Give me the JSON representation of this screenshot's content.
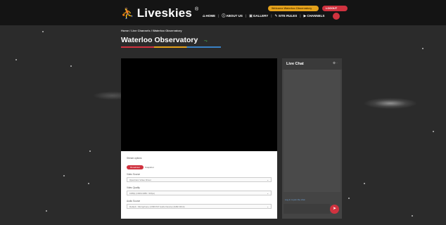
{
  "header": {
    "logo_text": "Liveskies",
    "logo_mark": "®",
    "welcome_label": "Welcome Waterloo Observatory",
    "logout_label": "LOGOUT",
    "nav": [
      {
        "icon": "home-icon",
        "label": "HOME"
      },
      {
        "icon": "info-icon",
        "label": "ABOUT US"
      },
      {
        "icon": "gallery-icon",
        "label": "GALLERY"
      },
      {
        "icon": "rules-icon",
        "label": "SITE RULES"
      },
      {
        "icon": "channels-icon",
        "label": "CHANNELS"
      }
    ]
  },
  "breadcrumb": {
    "home": "Home",
    "sep": "/",
    "channels": "Live Channels",
    "current": "Waterloo Observatory"
  },
  "page": {
    "title": "Waterloo Observatory"
  },
  "stream": {
    "section_label": "Stream options",
    "tabs": [
      "Broadcast",
      "Snapshot"
    ],
    "video_source_label": "Video Source",
    "video_source_value": "OpenCam Video Driver",
    "video_quality_label": "Video Quality",
    "video_quality_value": "1080p (1920x1080 / 30fps)",
    "audio_source_label": "Audio Source",
    "audio_source_value": "Default - Microphone (USB PnP Audio Device) (0d8c:0014)"
  },
  "chat": {
    "title": "Live Chat",
    "login_text": "Log in to join the chat"
  },
  "colors": {
    "accent_red": "#d0323f",
    "accent_orange": "#e4a11b",
    "accent_blue": "#3a82c6",
    "background": "#2b2b2b"
  }
}
